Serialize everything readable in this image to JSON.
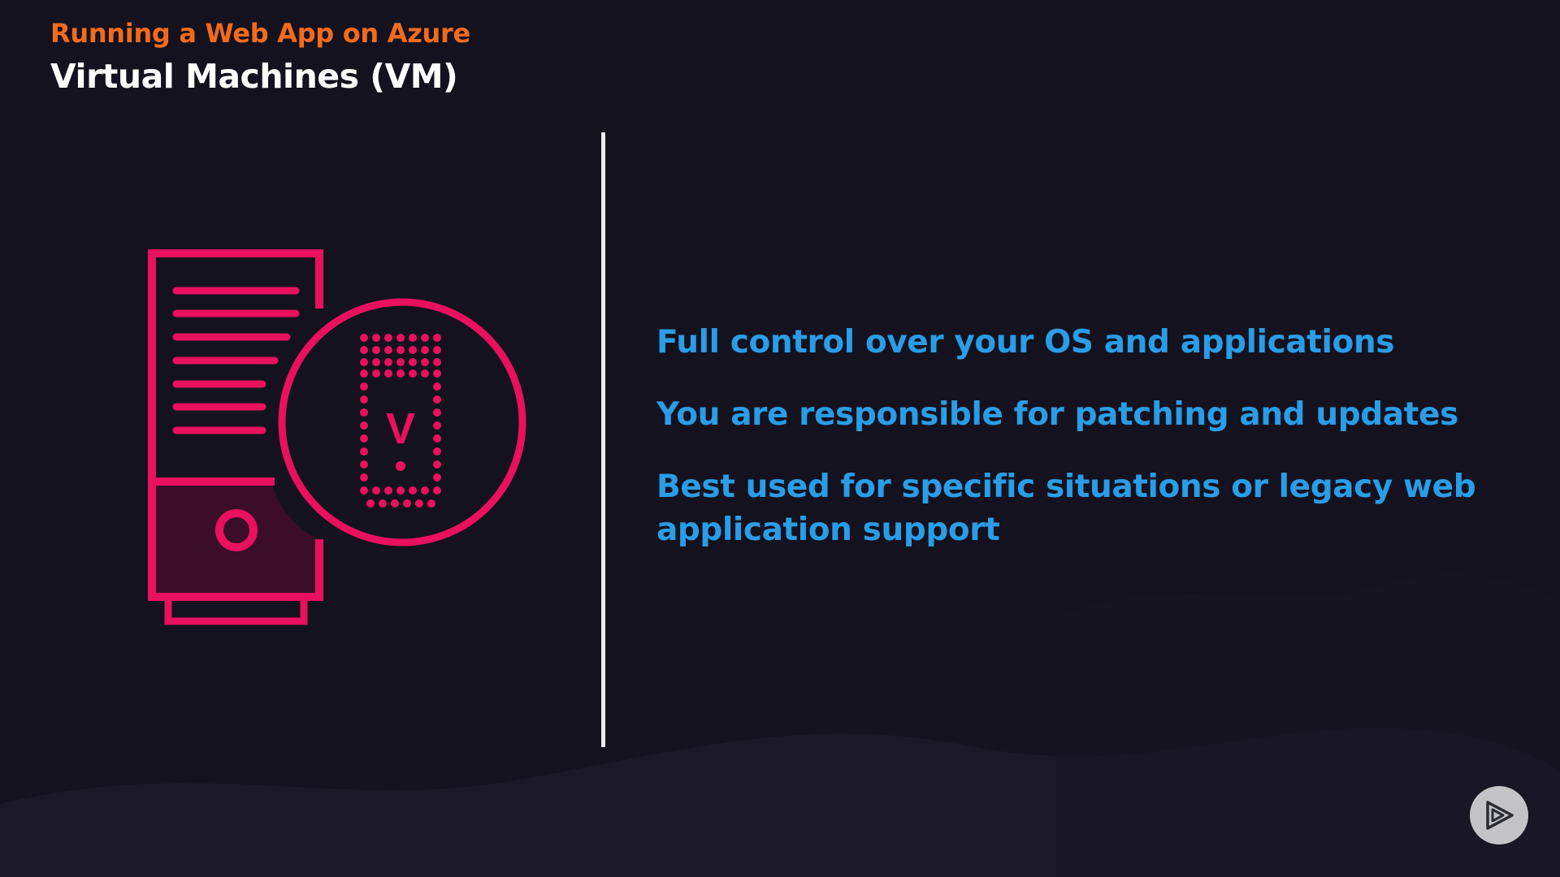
{
  "header": {
    "course_title": "Running a Web App on Azure",
    "slide_title": "Virtual Machines (VM)"
  },
  "illustration": {
    "icon": "virtual-machine-server-icon",
    "badge_letter": "V"
  },
  "bullets": [
    "Full control over your OS and applications",
    "You are responsible for patching and updates",
    "Best used for specific situations or legacy web application support"
  ],
  "player": {
    "icon": "play-logo-icon"
  },
  "colors": {
    "background": "#14121e",
    "course_title": "#f26b1d",
    "slide_title": "#ffffff",
    "bullet_text": "#2a9de6",
    "icon_accent": "#e8105f",
    "divider": "#ececf0"
  }
}
